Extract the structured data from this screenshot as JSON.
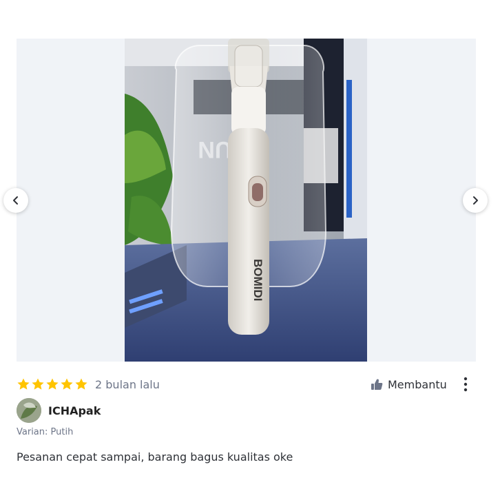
{
  "gallery": {
    "photo_alt": "BOMIDI",
    "prev_icon": "chevron-left-icon",
    "next_icon": "chevron-right-icon"
  },
  "review": {
    "rating": 5,
    "rating_max": 5,
    "time_ago": "2 bulan lalu",
    "helpful_label": "Membantu",
    "username": "ICHApak",
    "variant": "Varian: Putih",
    "text": "Pesanan cepat sampai, barang bagus kualitas oke"
  },
  "colors": {
    "star": "#ffc400",
    "secondary_text": "#6d7588",
    "primary_text": "#2e3137",
    "gallery_bg": "#f0f3f7"
  }
}
